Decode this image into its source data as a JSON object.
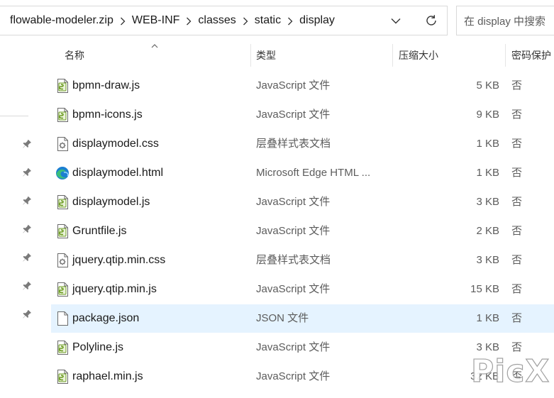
{
  "address_bar": {
    "breadcrumbs": [
      "flowable-modeler.zip",
      "WEB-INF",
      "classes",
      "static",
      "display"
    ]
  },
  "search": {
    "placeholder": "在 display 中搜索"
  },
  "columns": {
    "name": "名称",
    "type": "类型",
    "compressed_size": "压缩大小",
    "password_protected": "密码保护"
  },
  "files": [
    {
      "name": "bpmn-draw.js",
      "type": "JavaScript 文件",
      "size": "5 KB",
      "protected": "否",
      "icon": "js-file-icon"
    },
    {
      "name": "bpmn-icons.js",
      "type": "JavaScript 文件",
      "size": "9 KB",
      "protected": "否",
      "icon": "js-file-icon"
    },
    {
      "name": "displaymodel.css",
      "type": "层叠样式表文档",
      "size": "1 KB",
      "protected": "否",
      "icon": "css-file-icon"
    },
    {
      "name": "displaymodel.html",
      "type": "Microsoft Edge HTML ...",
      "size": "1 KB",
      "protected": "否",
      "icon": "edge-html-file-icon"
    },
    {
      "name": "displaymodel.js",
      "type": "JavaScript 文件",
      "size": "3 KB",
      "protected": "否",
      "icon": "js-file-icon"
    },
    {
      "name": "Gruntfile.js",
      "type": "JavaScript 文件",
      "size": "2 KB",
      "protected": "否",
      "icon": "js-file-icon"
    },
    {
      "name": "jquery.qtip.min.css",
      "type": "层叠样式表文档",
      "size": "3 KB",
      "protected": "否",
      "icon": "css-file-icon"
    },
    {
      "name": "jquery.qtip.min.js",
      "type": "JavaScript 文件",
      "size": "15 KB",
      "protected": "否",
      "icon": "js-file-icon"
    },
    {
      "name": "package.json",
      "type": "JSON 文件",
      "size": "1 KB",
      "protected": "否",
      "icon": "json-file-icon",
      "selected": true
    },
    {
      "name": "Polyline.js",
      "type": "JavaScript 文件",
      "size": "3 KB",
      "protected": "否",
      "icon": "js-file-icon"
    },
    {
      "name": "raphael.min.js",
      "type": "JavaScript 文件",
      "size": "32 KB",
      "protected": "否",
      "icon": "js-file-icon"
    }
  ],
  "watermark": "PicX",
  "colors": {
    "selected_row": "#e5f3ff",
    "js_icon_green": "#6a9a1f",
    "edge_blue": "#1b7fd1",
    "edge_green": "#3bbf7a"
  }
}
